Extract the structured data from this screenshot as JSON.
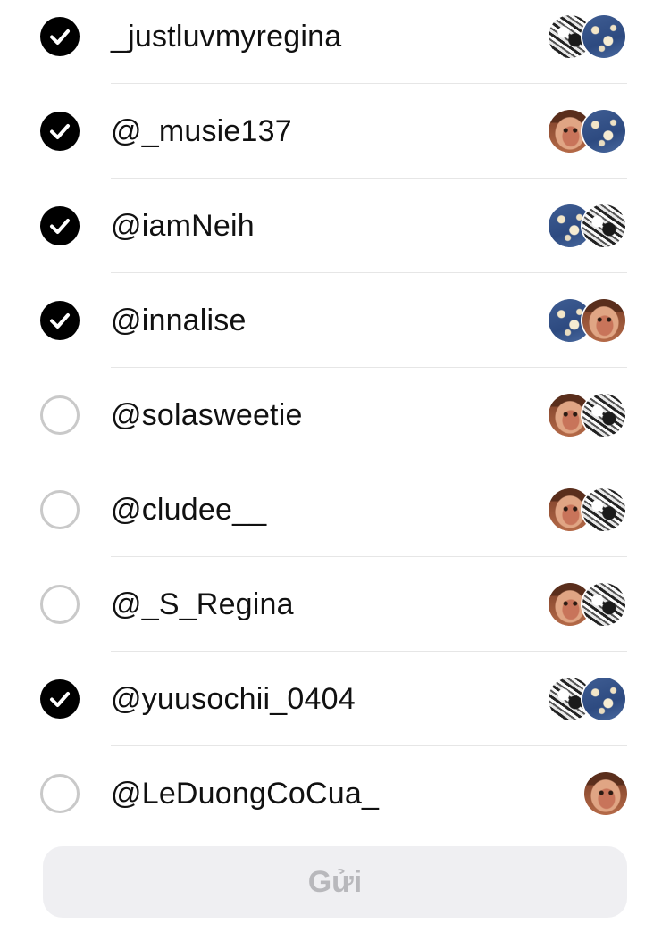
{
  "recipients": [
    {
      "username": "_justluvmyregina",
      "selected": true,
      "avatars": [
        "manga",
        "blue"
      ]
    },
    {
      "username": "@_musie137",
      "selected": true,
      "avatars": [
        "face",
        "blue"
      ]
    },
    {
      "username": "@iamNeih",
      "selected": true,
      "avatars": [
        "blue",
        "manga"
      ]
    },
    {
      "username": "@innalise",
      "selected": true,
      "avatars": [
        "blue",
        "face"
      ]
    },
    {
      "username": "@solasweetie",
      "selected": false,
      "avatars": [
        "face",
        "manga"
      ]
    },
    {
      "username": "@cludee__",
      "selected": false,
      "avatars": [
        "face",
        "manga"
      ]
    },
    {
      "username": "@_S_Regina",
      "selected": false,
      "avatars": [
        "face",
        "manga"
      ]
    },
    {
      "username": "@yuusochii_0404",
      "selected": true,
      "avatars": [
        "manga",
        "blue"
      ]
    },
    {
      "username": "@LeDuongCoCua_",
      "selected": false,
      "avatars": [
        "face"
      ]
    }
  ],
  "send_button": {
    "label": "Gửi",
    "enabled": false
  },
  "colors": {
    "check_selected": "#000000",
    "check_unselected_border": "#c9c9c9",
    "button_bg_disabled": "#efeff2",
    "button_text_disabled": "#b8b8bc"
  }
}
